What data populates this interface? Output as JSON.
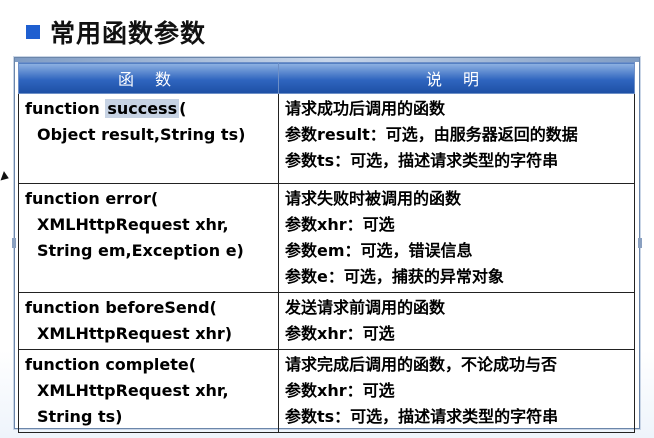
{
  "title": "常用函数参数",
  "table": {
    "headers": [
      "函  数",
      "说  明"
    ],
    "rows": [
      {
        "fn": [
          "function  ",
          "success",
          "(",
          "Object result,String ts)"
        ],
        "desc": [
          "请求成功后调用的函数",
          "参数result：可选，由服务器返回的数据",
          "参数ts：可选，描述请求类型的字符串"
        ]
      },
      {
        "fn": [
          "function error(",
          "XMLHttpRequest xhr,",
          "String em,Exception e)"
        ],
        "desc": [
          "请求失败时被调用的函数",
          "参数xhr：可选",
          "参数em：可选，错误信息",
          "参数e：可选，捕获的异常对象"
        ]
      },
      {
        "fn": [
          "function beforeSend(",
          "XMLHttpRequest xhr)"
        ],
        "desc": [
          "发送请求前调用的函数",
          "参数xhr：可选"
        ]
      },
      {
        "fn": [
          "function complete(",
          "XMLHttpRequest xhr,",
          "String ts)"
        ],
        "desc": [
          "请求完成后调用的函数，不论成功与否",
          "参数xhr：可选",
          "参数ts：可选，描述请求类型的字符串"
        ]
      }
    ]
  },
  "colors": {
    "bullet": "#1f5fd0",
    "header_bg": "#2f65bf",
    "highlight": "#c7d3e4"
  }
}
